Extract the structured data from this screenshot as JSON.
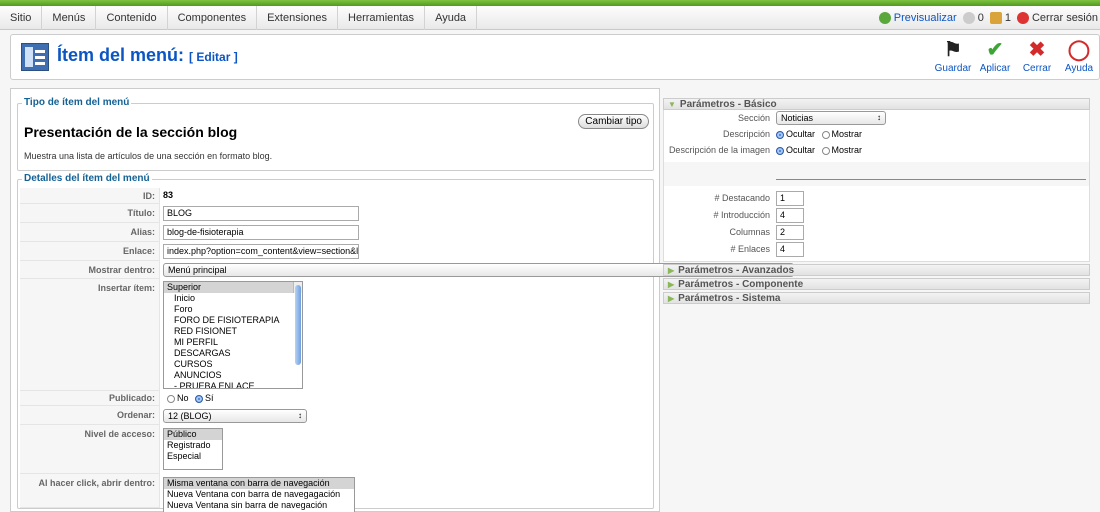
{
  "menu": [
    "Sitio",
    "Menús",
    "Contenido",
    "Componentes",
    "Extensiones",
    "Herramientas",
    "Ayuda"
  ],
  "status": {
    "preview": "Previsualizar",
    "count_a": "0",
    "count_b": "1",
    "logout": "Cerrar sesión"
  },
  "header": {
    "title": "Ítem del menú:",
    "subtitle": "[ Editar ]"
  },
  "toolbar": {
    "save": "Guardar",
    "apply": "Aplicar",
    "close": "Cerrar",
    "help": "Ayuda"
  },
  "type_section": {
    "legend": "Tipo de ítem del menú",
    "title": "Presentación de la sección blog",
    "description": "Muestra una lista de artículos de una sección en formato blog.",
    "change_button": "Cambiar tipo"
  },
  "details": {
    "legend": "Detalles del ítem del menú",
    "id_label": "ID:",
    "id_value": "83",
    "title_label": "Título:",
    "title_value": "BLOG",
    "alias_label": "Alias:",
    "alias_value": "blog-de-fisioterapia",
    "link_label": "Enlace:",
    "link_value": "index.php?option=com_content&view=section&la",
    "show_in_label": "Mostrar dentro:",
    "show_in_value": "Menú principal",
    "insert_label": "Insertar ítem:",
    "insert_items": [
      "Superior",
      "Inicio",
      "Foro",
      "FORO DE FISIOTERAPIA",
      "RED FISIONET",
      "MI PERFIL",
      "DESCARGAS",
      "CURSOS",
      "ANUNCIOS",
      " - PRUEBA ENLACE"
    ],
    "published_label": "Publicado:",
    "published_no": "No",
    "published_yes": "Sí",
    "order_label": "Ordenar:",
    "order_value": "12 (BLOG)",
    "access_label": "Nivel de acceso:",
    "access_items": [
      "Público",
      "Registrado",
      "Especial"
    ],
    "click_label": "Al hacer click, abrir dentro:",
    "click_items": [
      "Misma ventana con barra de navegación",
      "Nueva Ventana con barra de navegagación",
      "Nueva Ventana sin barra de navegación"
    ]
  },
  "params": {
    "basic_title": "Parámetros - Básico",
    "section_label": "Sección",
    "section_value": "Noticias",
    "desc_label": "Descripción",
    "desc_hide": "Ocultar",
    "desc_show": "Mostrar",
    "imgdesc_label": "Descripción de la imagen",
    "imgdesc_hide": "Ocultar",
    "imgdesc_show": "Mostrar",
    "featured_label": "# Destacando",
    "featured_value": "1",
    "intro_label": "# Introducción",
    "intro_value": "4",
    "columns_label": "Columnas",
    "columns_value": "2",
    "links_label": "# Enlaces",
    "links_value": "4",
    "advanced_title": "Parámetros - Avanzados",
    "component_title": "Parámetros - Componente",
    "system_title": "Parámetros - Sistema"
  }
}
